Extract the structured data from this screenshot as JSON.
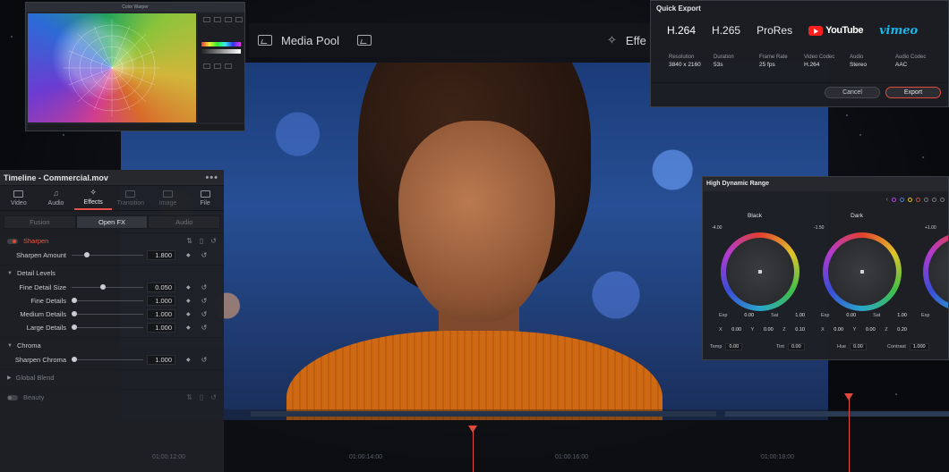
{
  "toolbar": {
    "media_pool": "Media Pool",
    "effects": "Effe"
  },
  "warper": {
    "title": "Color Warper"
  },
  "panel": {
    "title": "Timeline - Commercial.mov",
    "more": "•••",
    "tabs": [
      {
        "label": "Video"
      },
      {
        "label": "Audio"
      },
      {
        "label": "Effects"
      },
      {
        "label": "Transition"
      },
      {
        "label": "Image"
      },
      {
        "label": "File"
      }
    ],
    "subtabs": [
      "Fusion",
      "Open FX",
      "Audio"
    ],
    "sharpen": {
      "label": "Sharpen",
      "amount_label": "Sharpen Amount",
      "amount_value": "1.800"
    },
    "detail_levels": {
      "label": "Detail Levels",
      "params": [
        {
          "name": "Fine Detail Size",
          "value": "0.050"
        },
        {
          "name": "Fine Details",
          "value": "1.000"
        },
        {
          "name": "Medium Details",
          "value": "1.000"
        },
        {
          "name": "Large Details",
          "value": "1.000"
        }
      ]
    },
    "chroma": {
      "label": "Chroma",
      "param_name": "Sharpen Chroma",
      "param_value": "1.000"
    },
    "global_blend": "Global Blend",
    "beauty": "Beauty"
  },
  "quick_export": {
    "title": "Quick Export",
    "formats": [
      "H.264",
      "H.265",
      "ProRes"
    ],
    "youtube": "YouTube",
    "vimeo": "vimeo",
    "info": [
      {
        "key": "Resolution",
        "value": "3840 x 2160"
      },
      {
        "key": "Duration",
        "value": "53s"
      },
      {
        "key": "Frame Rate",
        "value": "25 fps"
      },
      {
        "key": "Video Codec",
        "value": "H.264"
      },
      {
        "key": "Audio",
        "value": "Stereo"
      },
      {
        "key": "Audio Codec",
        "value": "AAC"
      }
    ],
    "cancel": "Cancel",
    "export": "Export"
  },
  "hdr": {
    "title": "High Dynamic Range",
    "wheels": [
      {
        "label": "Black",
        "value": "-4.00",
        "exp": "0.00",
        "sat": "1.00",
        "x": "0.00",
        "y": "0.00",
        "z": "0.10"
      },
      {
        "label": "Dark",
        "value": "-1.50",
        "exp": "0.00",
        "sat": "1.00",
        "x": "0.00",
        "y": "0.00",
        "z": "0.20"
      },
      {
        "label": "",
        "value": "+1.00",
        "exp": "",
        "sat": "",
        "x": "",
        "y": "",
        "z": ""
      }
    ],
    "labels": {
      "exp": "Exp",
      "sat": "Sat",
      "x": "X",
      "y": "Y",
      "z": "Z"
    },
    "footer": [
      {
        "key": "Temp",
        "value": "0.00"
      },
      {
        "key": "Tint",
        "value": "0.00"
      },
      {
        "key": "Hue",
        "value": "0.00"
      },
      {
        "key": "Contrast",
        "value": "1.000"
      }
    ]
  },
  "timeline": {
    "timecodes": [
      "01:00:12:00",
      "01:00:14:00",
      "01:00:16:00",
      "01:00:18:00"
    ]
  }
}
